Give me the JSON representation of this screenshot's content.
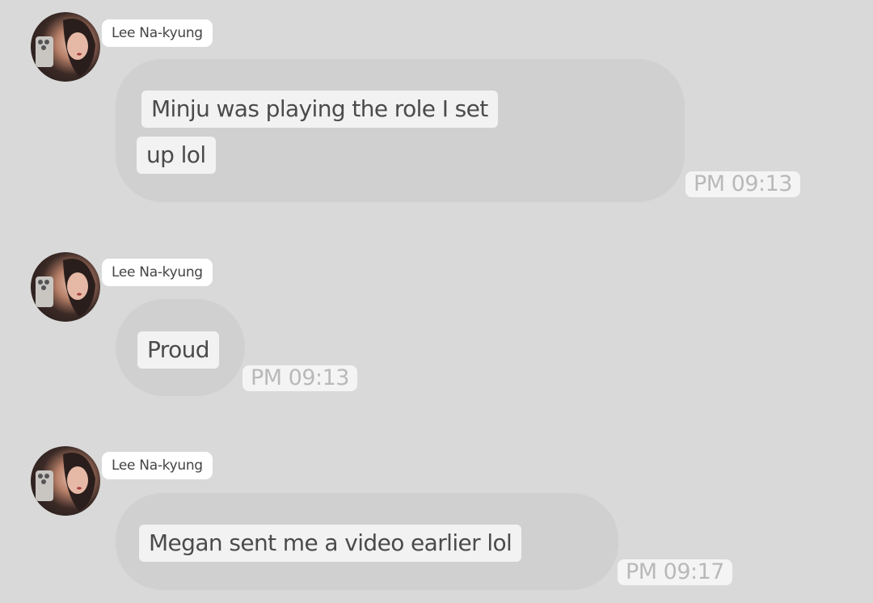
{
  "messages": [
    {
      "sender": "Lee Na-kyung",
      "lines": [
        "Minju was playing the role I set",
        "up lol"
      ],
      "time": "PM 09:13"
    },
    {
      "sender": "Lee Na-kyung",
      "lines": [
        "Proud"
      ],
      "time": "PM 09:13"
    },
    {
      "sender": "Lee Na-kyung",
      "lines": [
        "Megan sent me a video earlier lol"
      ],
      "time": "PM 09:17"
    }
  ],
  "icons": {
    "avatar": "profile-photo-avatar"
  },
  "colors": {
    "background": "#d9d9d9",
    "bubble": "#d0d0d0",
    "text_highlight": "#f2f2f2",
    "name_tag": "#ffffff",
    "timestamp_text": "#b9b9b9"
  }
}
